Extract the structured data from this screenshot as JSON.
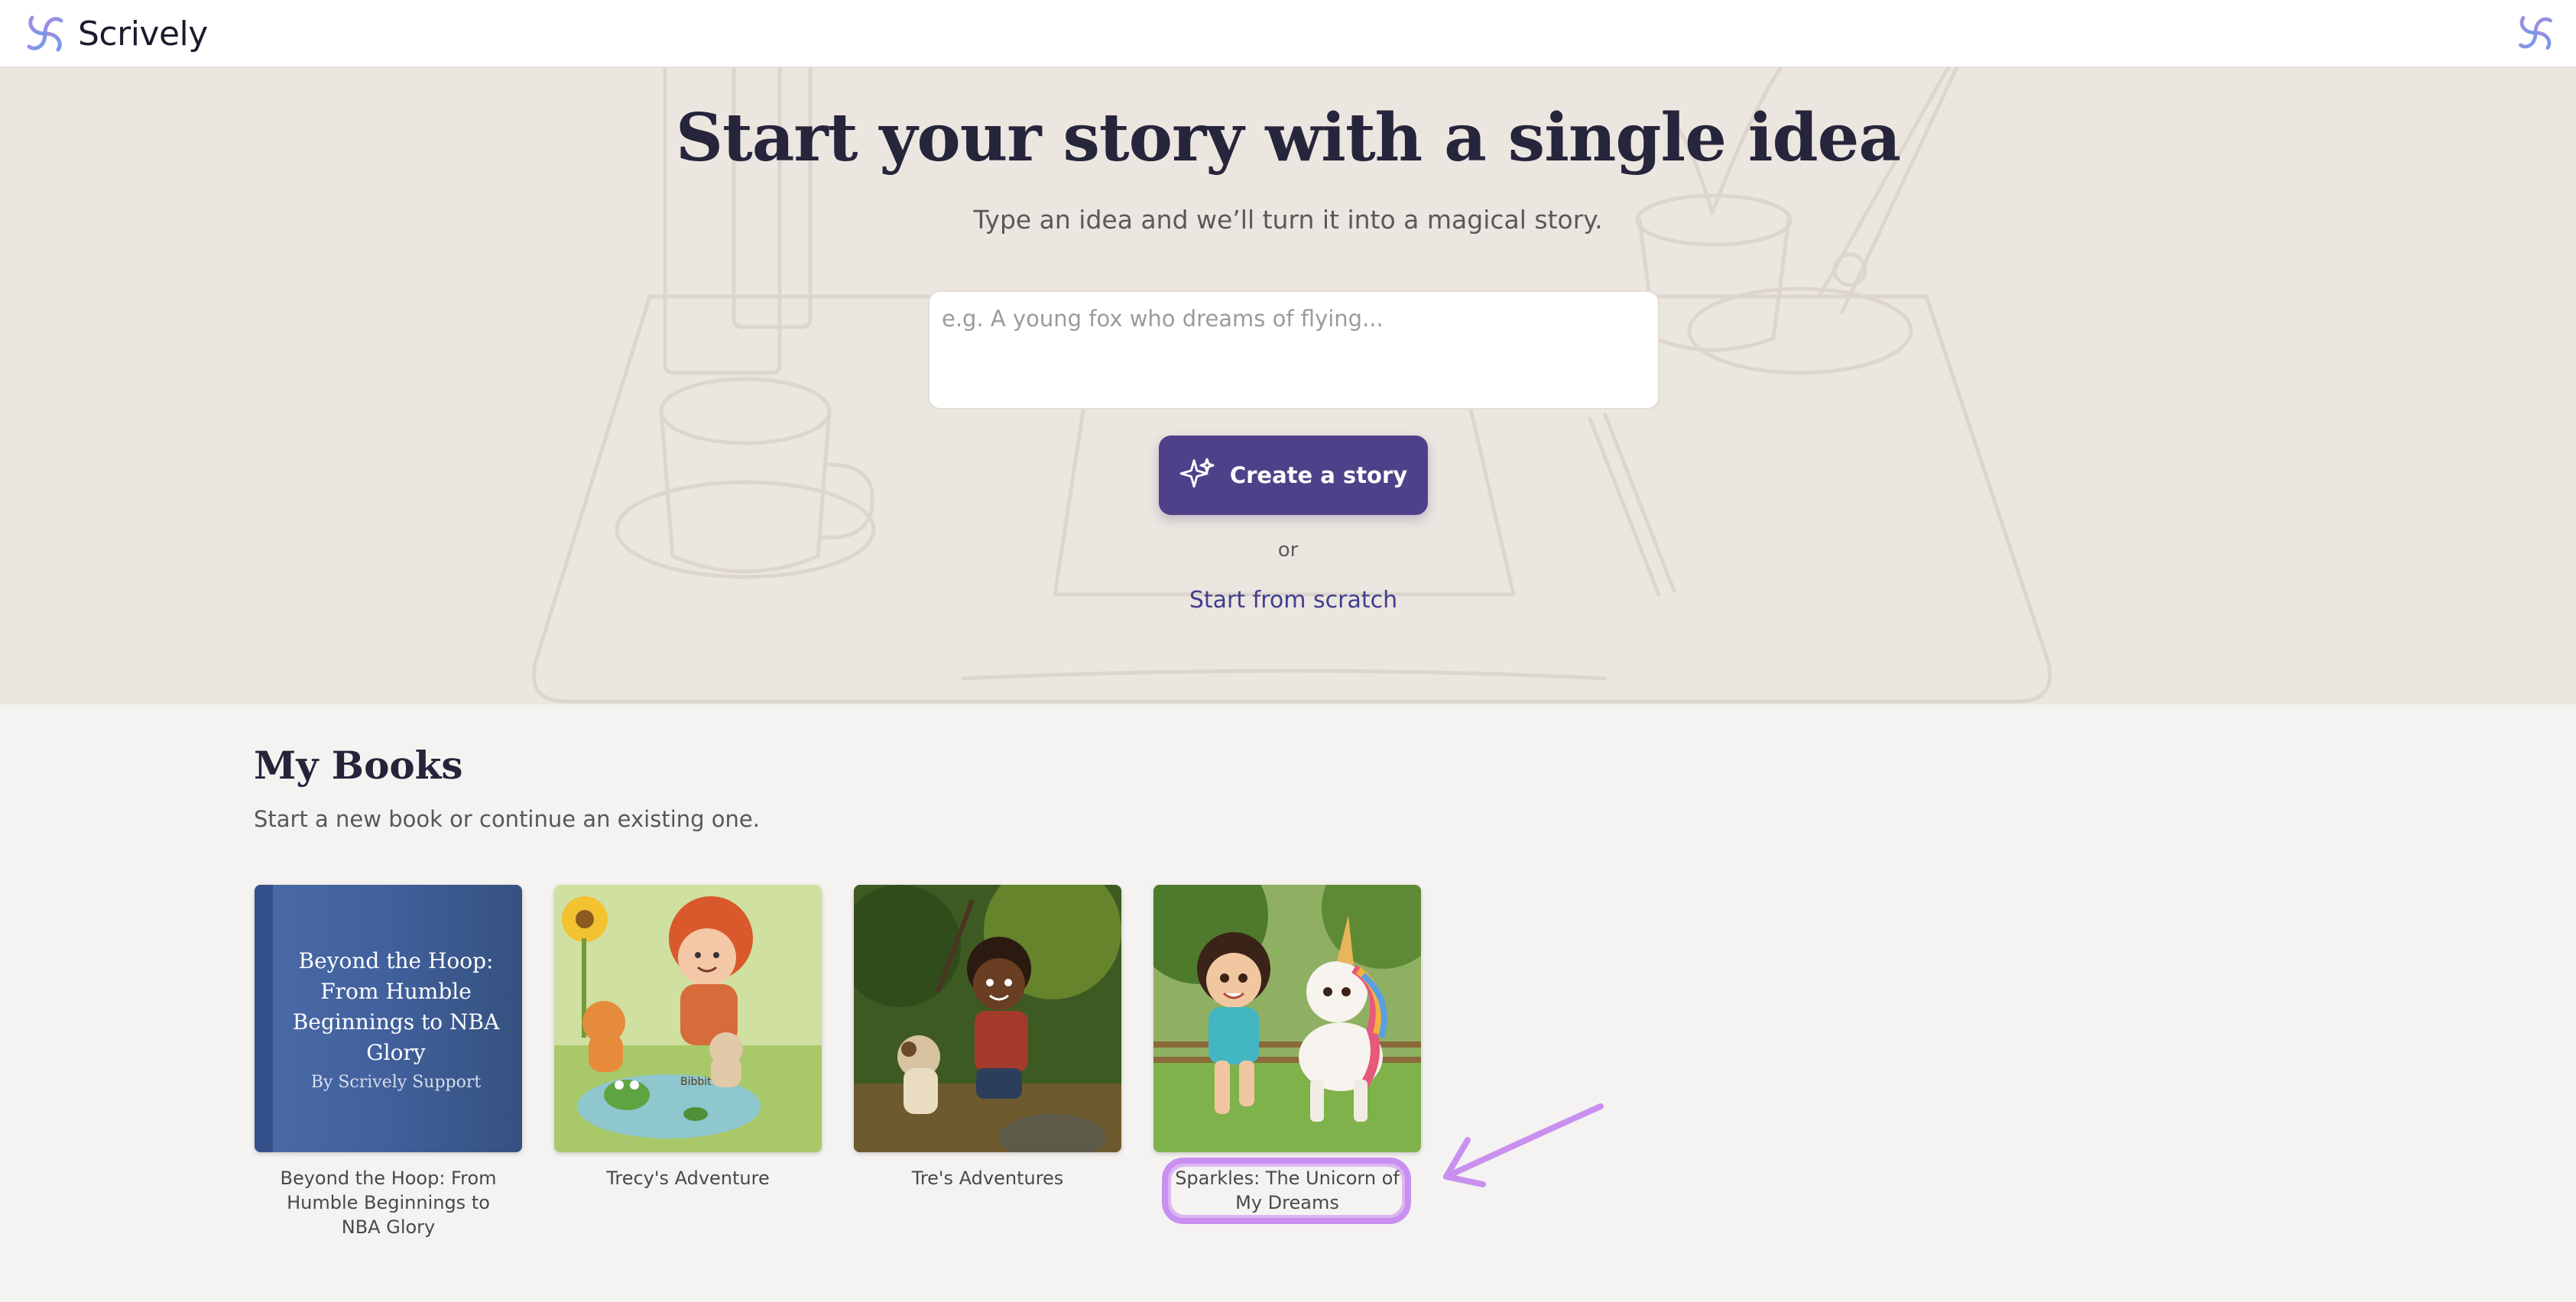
{
  "app": {
    "name": "Scrively"
  },
  "hero": {
    "title": "Start your story with a single idea",
    "subtitle": "Type an idea and we’ll turn it into a magical story.",
    "input_placeholder": "e.g. A young fox who dreams of flying...",
    "input_value": "",
    "create_button": "Create a story",
    "or_text": "or",
    "scratch_link": "Start from scratch"
  },
  "books_section": {
    "title": "My Books",
    "subtitle": "Start a new book or continue an existing one.",
    "books": [
      {
        "title": "Beyond the Hoop: From Humble Beginnings to NBA Glory",
        "cover_title": "Beyond the Hoop: From Humble Beginnings to NBA Glory",
        "cover_author": "By Scrively Support"
      },
      {
        "title": "Trecy's Adventure",
        "cover_text": "Bibbit"
      },
      {
        "title": "Tre's Adventures"
      },
      {
        "title": "Sparkles: The Unicorn of My Dreams"
      }
    ]
  },
  "colors": {
    "accent": "#4f4189",
    "link": "#3f3d8f",
    "annotation": "#c990f0"
  }
}
